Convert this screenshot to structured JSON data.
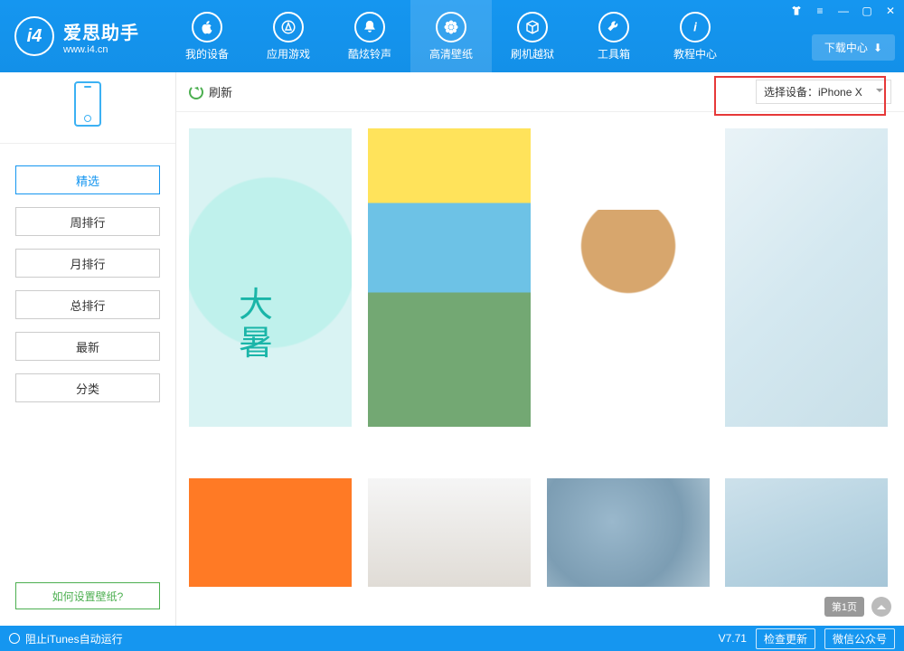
{
  "app": {
    "title": "爱思助手",
    "subtitle": "www.i4.cn",
    "logo_letter": "i4"
  },
  "nav": {
    "items": [
      {
        "label": "我的设备",
        "icon": "apple-icon"
      },
      {
        "label": "应用游戏",
        "icon": "appstore-icon"
      },
      {
        "label": "酷炫铃声",
        "icon": "bell-icon"
      },
      {
        "label": "高清壁纸",
        "icon": "flower-icon"
      },
      {
        "label": "刷机越狱",
        "icon": "box-icon"
      },
      {
        "label": "工具箱",
        "icon": "tools-icon"
      },
      {
        "label": "教程中心",
        "icon": "info-icon"
      }
    ],
    "active_index": 3
  },
  "window": {
    "download_center": "下载中心"
  },
  "sidebar": {
    "items": [
      {
        "label": "精选"
      },
      {
        "label": "周排行"
      },
      {
        "label": "月排行"
      },
      {
        "label": "总排行"
      },
      {
        "label": "最新"
      },
      {
        "label": "分类"
      }
    ],
    "active_index": 0,
    "help_link": "如何设置壁纸?"
  },
  "toolbar": {
    "refresh_label": "刷新",
    "device_label": "选择设备：",
    "device_value": "iPhone X"
  },
  "pager": {
    "page_label": "第1页"
  },
  "footer": {
    "itunes_label": "阻止iTunes自动运行",
    "version": "V7.71",
    "check_update": "检查更新",
    "wechat": "微信公众号"
  }
}
